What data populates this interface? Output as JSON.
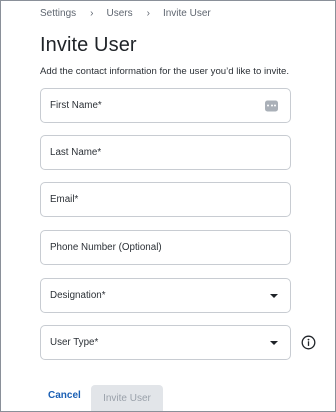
{
  "breadcrumb": [
    "Settings",
    "Users",
    "Invite User"
  ],
  "page": {
    "title": "Invite User",
    "subtitle": "Add the contact information for the user you’d like to invite."
  },
  "fields": {
    "first_name": "First Name*",
    "last_name": "Last Name*",
    "email": "Email*",
    "phone": "Phone Number (Optional)",
    "designation": "Designation*",
    "user_type": "User Type*"
  },
  "icons": {
    "first_name_badge": "more-dots-icon",
    "dropdown": "caret-down-icon",
    "info": "info-icon"
  },
  "actions": {
    "cancel": "Cancel",
    "invite": "Invite User"
  },
  "colors": {
    "link": "#1a5fb4",
    "disabled_button_bg": "#e2e5e9",
    "disabled_button_text": "#9aa1aa",
    "border": "#c8ccd2"
  }
}
